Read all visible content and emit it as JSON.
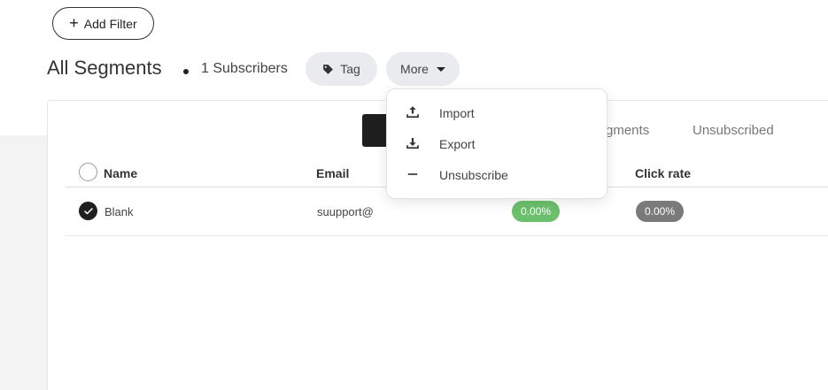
{
  "toolbar": {
    "add_filter_label": "Add Filter"
  },
  "header": {
    "title": "All Segments",
    "subscriber_count": "1 Subscribers",
    "tag_label": "Tag",
    "more_label": "More"
  },
  "tabs": {
    "segments_partial": "gments",
    "unsubscribed": "Unsubscribed"
  },
  "table": {
    "columns": [
      "Name",
      "Email",
      "Click rate"
    ],
    "rows": [
      {
        "name": "Blank",
        "email": "suupport@",
        "open_rate": "0.00%",
        "click_rate": "0.00%"
      }
    ]
  },
  "more_menu": {
    "items": [
      {
        "label": "Import",
        "icon": "upload-icon"
      },
      {
        "label": "Export",
        "icon": "download-icon"
      },
      {
        "label": "Unsubscribe",
        "icon": "minus-icon"
      }
    ]
  },
  "colors": {
    "open_rate_badge": "#6cbf6c",
    "click_rate_badge": "#7a7a7a",
    "chip_bg": "#e9ebee",
    "dark": "#1f1f1f"
  }
}
